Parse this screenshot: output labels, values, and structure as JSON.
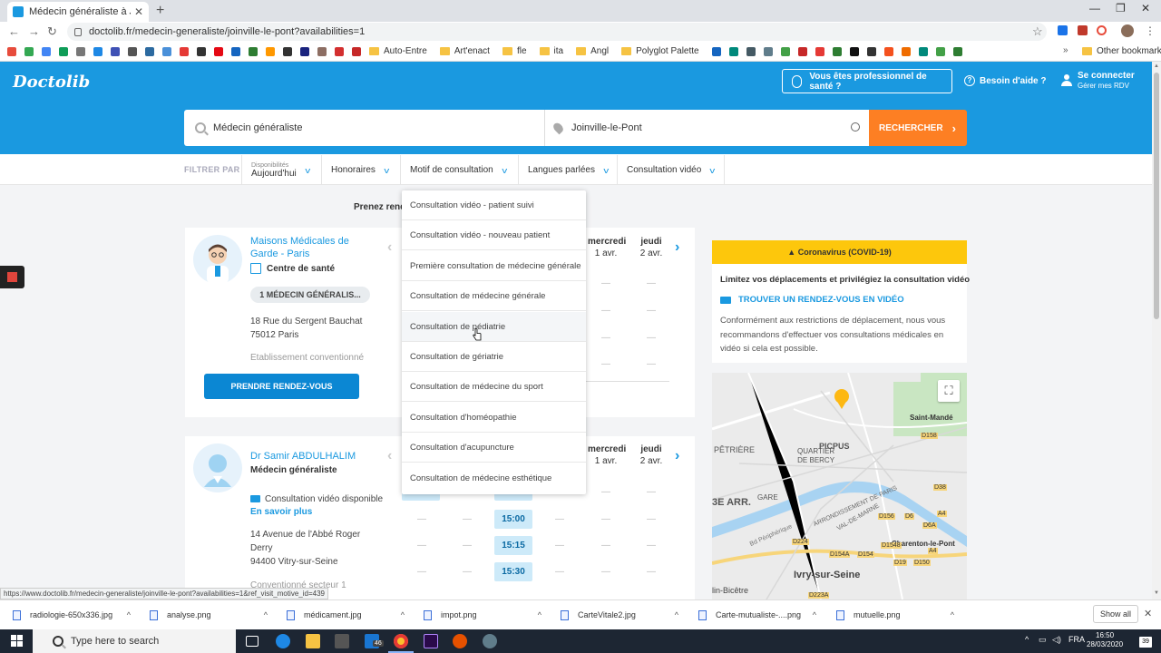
{
  "browser": {
    "tab_title": "Médecin généraliste à Joinville-le-",
    "url": "doctolib.fr/medecin-generaliste/joinville-le-pont?availabilities=1",
    "bookmark_folders": [
      "Auto-Entre",
      "Art'enact",
      "fle",
      "ita",
      "Angl",
      "Polyglot Palette"
    ],
    "other_bookmarks": "Other bookmarks",
    "status_url": "https://www.doctolib.fr/medecin-generaliste/joinville-le-pont?availabilities=1&ref_visit_motive_id=439"
  },
  "header": {
    "logo": "Doctolib",
    "pro_button": "Vous êtes professionnel de santé ?",
    "help": "Besoin d'aide ?",
    "login_title": "Se connecter",
    "login_sub": "Gérer mes RDV"
  },
  "search": {
    "specialty": "Médecin généraliste",
    "location": "Joinville-le-Pont",
    "button": "RECHERCHER"
  },
  "filters": {
    "label": "FILTRER PAR",
    "dispo_small": "Disponibilités",
    "dispo_value": "Aujourd'hui",
    "honoraires": "Honoraires",
    "motif": "Motif de consultation",
    "langues": "Langues parlées",
    "video": "Consultation vidéo"
  },
  "prenez": "Prenez rende",
  "dropdown": {
    "items": [
      "Consultation vidéo - patient suivi",
      "Consultation vidéo - nouveau patient",
      "Première consultation de médecine générale",
      "Consultation de médecine générale",
      "Consultation de pédiatrie",
      "Consultation de gériatrie",
      "Consultation de médecine du sport",
      "Consultation d'homéopathie",
      "Consultation d'acupuncture",
      "Consultation de médecine esthétique"
    ]
  },
  "card1": {
    "name_line1": "Maisons Médicales de",
    "name_line2": "Garde - Paris",
    "type": "Centre de santé",
    "pill": "1 MÉDECIN GÉNÉRALIS...",
    "addr1": "18 Rue du Sergent Bauchat",
    "addr2": "75012 Paris",
    "conv": "Etablissement conventionné",
    "book": "PRENDRE RENDEZ-VOUS",
    "day1_name": "mercredi",
    "day1_date": "1 avr.",
    "day2_name": "jeudi",
    "day2_date": "2 avr."
  },
  "card2": {
    "name": "Dr Samir ABDULHALIM",
    "type": "Médecin généraliste",
    "video": "Consultation vidéo disponible",
    "more": "En savoir plus",
    "addr1": "14 Avenue de l'Abbé Roger",
    "addr2": "Derry",
    "addr3": "94400 Vitry-sur-Seine",
    "conv": "Conventionné secteur 1",
    "day1_name": "mercredi",
    "day1_date": "1 avr.",
    "day2_name": "jeudi",
    "day2_date": "2 avr.",
    "slots": [
      "15:00",
      "15:15",
      "15:30"
    ]
  },
  "covid": {
    "title": "Coronavirus (COVID-19)",
    "line1": "Limitez vos déplacements et privilégiez la consultation vidéo",
    "link": "TROUVER UN RENDEZ-VOUS EN VIDÉO",
    "text": "Conformément aux restrictions de déplacement, nous vous recommandons d'effectuer vos consultations médicales en vidéo si cela est possible."
  },
  "map": {
    "labels": {
      "saint_mande": "Saint-Mandé",
      "picpus": "PICPUS",
      "petriere": "PÊTRIÈRE",
      "quartier1": "QUARTIER",
      "quartier2": "DE BERCY",
      "arr": "3E ARR.",
      "gare": "GARE",
      "charenton": "Charenton-le-Pont",
      "ivry": "Ivry-sur-Seine",
      "bicetre": "lin-Bicêtre",
      "val": "VAL-DE-MARNE",
      "periph": "Bd Périphérique",
      "arrond": "ARRONDISSEMENT DE PARIS"
    },
    "roads": [
      "D158",
      "D38",
      "A4",
      "D156",
      "D6",
      "D6A",
      "D1548",
      "D154A",
      "D154",
      "D224",
      "D19",
      "D150",
      "A4",
      "D223A"
    ]
  },
  "downloads": {
    "items": [
      "radiologie-650x336.jpg",
      "analyse.png",
      "médicament.jpg",
      "impot.png",
      "CarteVitale2.jpg",
      "Carte-mutualiste-....png",
      "mutuelle.png"
    ],
    "show_all": "Show all"
  },
  "taskbar": {
    "search": "Type here to search",
    "badge": "46",
    "lang": "FRA",
    "time": "16:50",
    "date": "28/03/2020",
    "notif": "39"
  }
}
